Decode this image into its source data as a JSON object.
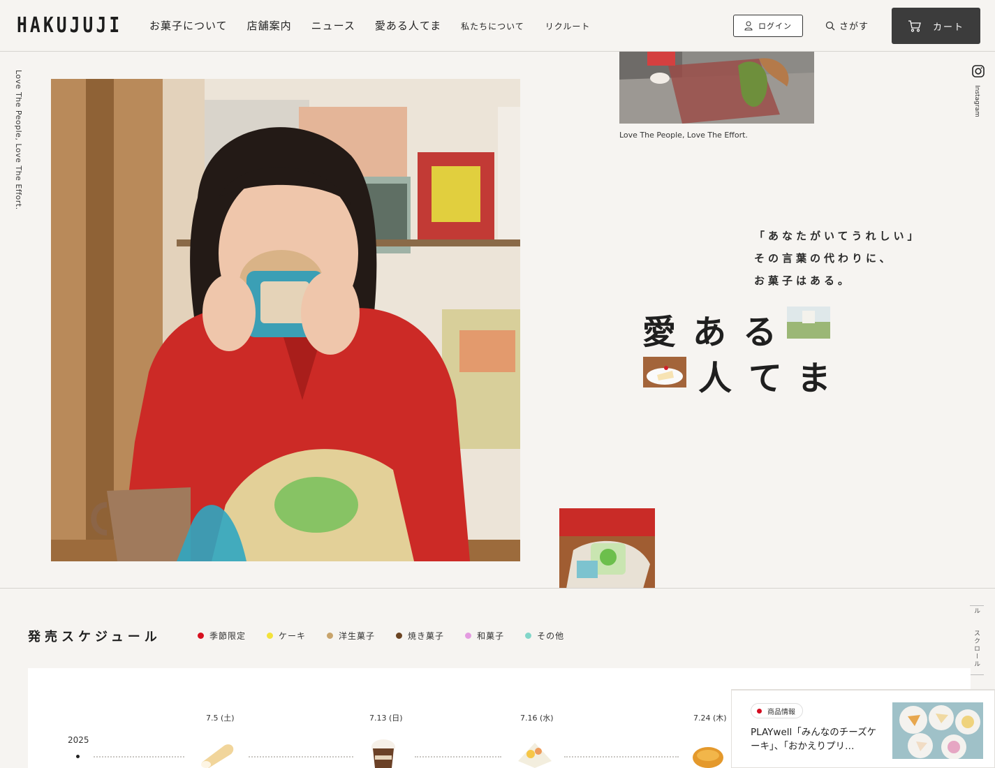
{
  "header": {
    "logo": "HAKUJUJI",
    "nav": [
      {
        "label": "お菓子について",
        "size": "big"
      },
      {
        "label": "店舗案内",
        "size": "big"
      },
      {
        "label": "ニュース",
        "size": "big"
      },
      {
        "label": "愛ある人てま",
        "size": "big"
      },
      {
        "label": "私たちについて",
        "size": "small"
      },
      {
        "label": "リクルート",
        "size": "small"
      }
    ],
    "login_label": "ログイン",
    "search_label": "さがす",
    "cart_label": "カート"
  },
  "side": {
    "left_text": "Love The People, Love The Effort.",
    "instagram_label": "Instagram"
  },
  "hero": {
    "top_caption": "Love The People, Love The Effort.",
    "tagline": [
      "「あなたがいてうれしい」",
      "その言葉の代わりに、",
      "お菓子はある。"
    ],
    "title_line1": "愛ある",
    "title_line2": "人てま"
  },
  "schedule": {
    "title": "発売スケジュール",
    "legend": [
      {
        "label": "季節限定",
        "color": "#d7101f"
      },
      {
        "label": "ケーキ",
        "color": "#f3e23a"
      },
      {
        "label": "洋生菓子",
        "color": "#c8a46c"
      },
      {
        "label": "焼き菓子",
        "color": "#6b4423"
      },
      {
        "label": "和菓子",
        "color": "#e39be0"
      },
      {
        "label": "その他",
        "color": "#82d6c9"
      }
    ],
    "scroll_label": "スクロール",
    "scroll_mini": "ル",
    "year": "2025",
    "dates": [
      "7.5 (土)",
      "7.13 (日)",
      "7.16 (水)",
      "7.24 (木)"
    ]
  },
  "news": {
    "badge": "商品情報",
    "text": "PLAYwell「みんなのチーズケーキ」、「おかえりプリ…"
  },
  "colors": {
    "background": "#f6f4f1",
    "cart_bg": "#3c3c3c",
    "accent_red": "#d40c1f"
  }
}
